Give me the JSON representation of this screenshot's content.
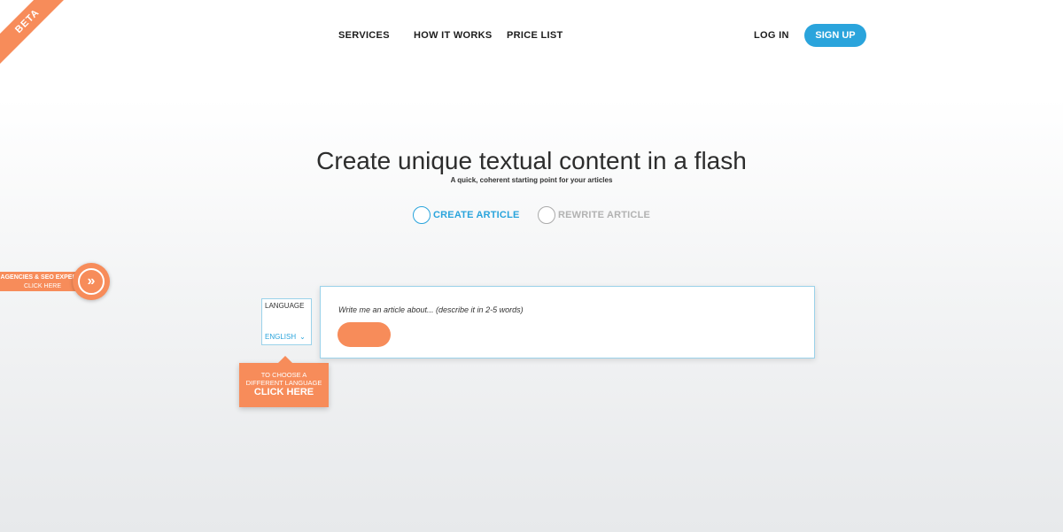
{
  "beta_label": "BETA",
  "nav": {
    "services": "SERVICES",
    "how_it_works": "HOW IT WORKS",
    "price_list": "PRICE LIST",
    "login": "LOG IN",
    "signup": "SIGN UP"
  },
  "hero": {
    "title": "Create unique textual content in a flash",
    "subtitle": "A quick, coherent starting point for your articles"
  },
  "mode": {
    "options": [
      {
        "label": "CREATE ARTICLE",
        "selected": true
      },
      {
        "label": "REWRITE ARTICLE",
        "selected": false
      }
    ]
  },
  "agency": {
    "line1": "AGENCIES & SEO EXPERTS",
    "line2": "CLICK HERE",
    "icon": "double-chevron-right-icon"
  },
  "language": {
    "title": "LANGUAGE",
    "selected": "ENGLISH",
    "callout_line1": "TO CHOOSE A",
    "callout_line2": "DIFFERENT LANGUAGE",
    "callout_line3": "CLICK HERE"
  },
  "article": {
    "placeholder": "Write me an article about... (describe it in 2-5 words)",
    "value": "",
    "button_label": ""
  },
  "colors": {
    "accent_blue": "#2aa4dc",
    "accent_orange": "#f78c5a"
  }
}
